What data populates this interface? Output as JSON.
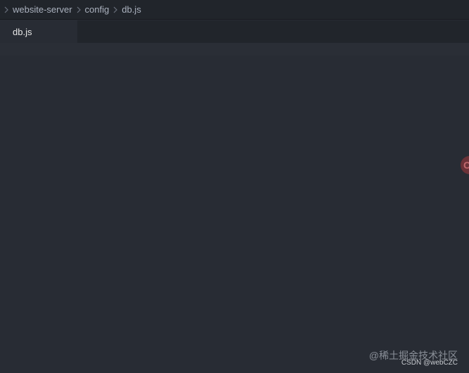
{
  "breadcrumb": {
    "items": [
      {
        "label": "website-server"
      },
      {
        "label": "config"
      },
      {
        "label": "db.js"
      }
    ]
  },
  "tabs": [
    {
      "label": "db.js",
      "active": true
    }
  ],
  "side_badge": {
    "label": "C"
  },
  "watermarks": {
    "line1": "@稀土掘金技术社区",
    "line2": "CSDN @webCZC"
  },
  "icons": {
    "separator": "chevron-right-icon"
  },
  "colors": {
    "editor_bg": "#282c34",
    "chrome_bg": "#21252b",
    "text": "#abb2bf"
  }
}
